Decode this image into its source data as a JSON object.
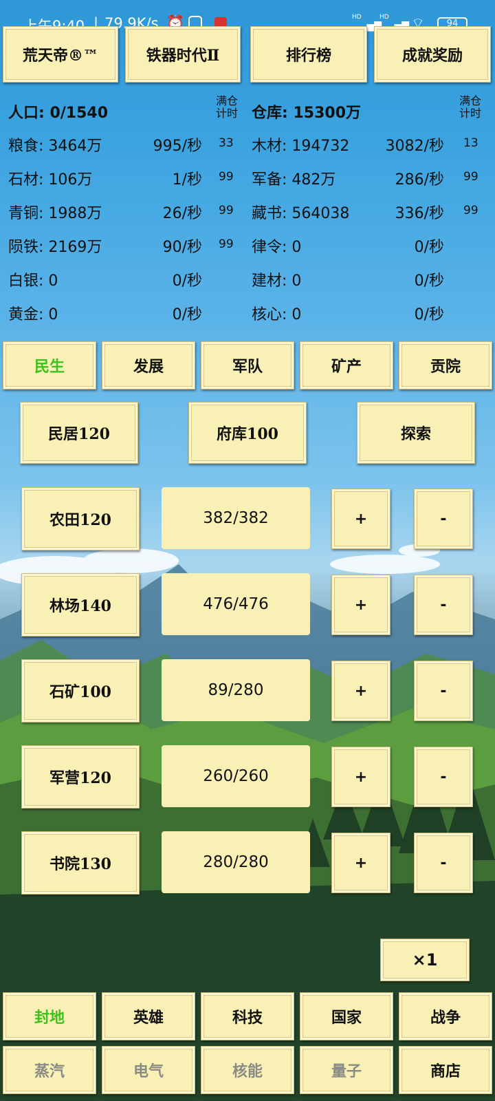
{
  "status_bar": {
    "time": "上午9:40",
    "speed": "79.9K/s",
    "signal1": "HD",
    "signal2": "HD",
    "battery": "94"
  },
  "top_tabs": [
    {
      "label": "荒天帝®™"
    },
    {
      "label": "铁器时代Ⅱ"
    },
    {
      "label": "排行榜"
    },
    {
      "label": "成就奖励"
    }
  ],
  "resources": {
    "population": "人口: 0/1540",
    "warehouse": "仓库: 15300万",
    "full_timer_label": "满仓\n计时",
    "left": [
      {
        "name": "粮食: 3464万",
        "rate": "995/秒",
        "timer": "33"
      },
      {
        "name": "石材: 106万",
        "rate": "1/秒",
        "timer": "99"
      },
      {
        "name": "青铜: 1988万",
        "rate": "26/秒",
        "timer": "99"
      },
      {
        "name": "陨铁: 2169万",
        "rate": "90/秒",
        "timer": "99"
      },
      {
        "name": "白银: 0",
        "rate": "0/秒",
        "timer": ""
      },
      {
        "name": "黄金: 0",
        "rate": "0/秒",
        "timer": ""
      }
    ],
    "right": [
      {
        "name": "木材: 194732",
        "rate": "3082/秒",
        "timer": "13"
      },
      {
        "name": "军备: 482万",
        "rate": "286/秒",
        "timer": "99"
      },
      {
        "name": "藏书: 564038",
        "rate": "336/秒",
        "timer": "99"
      },
      {
        "name": "律令: 0",
        "rate": "0/秒",
        "timer": ""
      },
      {
        "name": "建材: 0",
        "rate": "0/秒",
        "timer": ""
      },
      {
        "name": "核心: 0",
        "rate": "0/秒",
        "timer": ""
      }
    ]
  },
  "category_tabs": [
    {
      "label": "民生"
    },
    {
      "label": "发展"
    },
    {
      "label": "军队"
    },
    {
      "label": "矿产"
    },
    {
      "label": "贡院"
    }
  ],
  "actions": [
    {
      "label": "民居120"
    },
    {
      "label": "府库100"
    },
    {
      "label": "探索"
    }
  ],
  "buildings": [
    {
      "label": "农田120",
      "workers": "382/382",
      "plus": "+",
      "minus": "-"
    },
    {
      "label": "林场140",
      "workers": "476/476",
      "plus": "+",
      "minus": "-"
    },
    {
      "label": "石矿100",
      "workers": "89/280",
      "plus": "+",
      "minus": "-"
    },
    {
      "label": "军营120",
      "workers": "260/260",
      "plus": "+",
      "minus": "-"
    },
    {
      "label": "书院130",
      "workers": "280/280",
      "plus": "+",
      "minus": "-"
    }
  ],
  "multiplier": "×1",
  "bottom_nav_row1": [
    {
      "label": "封地"
    },
    {
      "label": "英雄"
    },
    {
      "label": "科技"
    },
    {
      "label": "国家"
    },
    {
      "label": "战争"
    }
  ],
  "bottom_nav_row2": [
    {
      "label": "蒸汽"
    },
    {
      "label": "电气"
    },
    {
      "label": "核能"
    },
    {
      "label": "量子"
    },
    {
      "label": "商店"
    }
  ],
  "colors": {
    "active_tab": "#3ec11c",
    "button_bg": "#f8f0b4",
    "dim_text": "#8a8a86",
    "sky": "#2e97d6"
  }
}
